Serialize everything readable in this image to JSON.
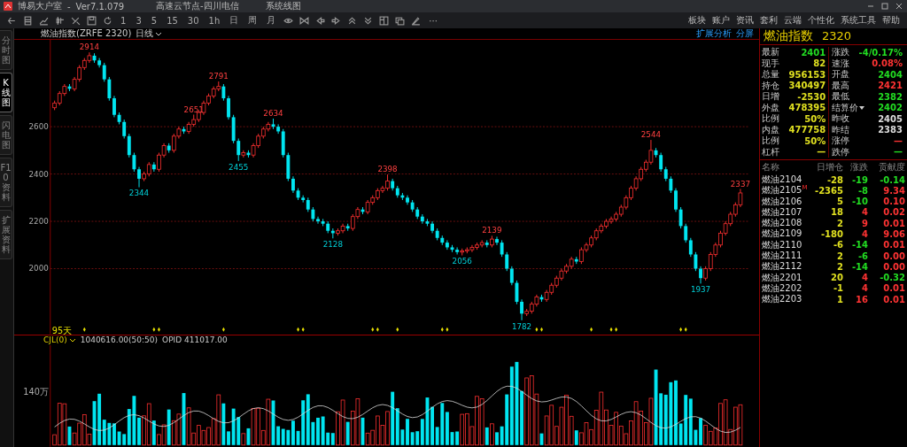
{
  "window": {
    "title": "博易大户室",
    "separator": "-",
    "version": "Ver7.1.079",
    "server": "高速云节点-四川电信",
    "view": "系统线图"
  },
  "menu": [
    "板块",
    "账户",
    "资讯",
    "套利",
    "云端",
    "个性化",
    "系统工具",
    "帮助"
  ],
  "toolbar": {
    "periods": [
      "1",
      "3",
      "5",
      "15",
      "30",
      "1h",
      "日",
      "周",
      "月"
    ],
    "more": "···"
  },
  "side_tabs": [
    {
      "label": "分时图",
      "selected": false
    },
    {
      "label": "K线图",
      "selected": true
    },
    {
      "label": "闪电图",
      "selected": false
    },
    {
      "label": "F10资料",
      "selected": false
    },
    {
      "label": "扩展资料",
      "selected": false
    }
  ],
  "chart_header": {
    "symbol": "燃油指数(ZRFE 2320)",
    "period": "日线",
    "analysis": "扩展分析",
    "split": "分屏"
  },
  "chart_data": {
    "type": "candlestick",
    "grid": true,
    "ylim": [
      1723,
      2967
    ],
    "yticks": [
      2000,
      2200,
      2400,
      2600
    ],
    "ohlc": [
      [
        2680,
        2710,
        2670,
        2700
      ],
      [
        2700,
        2750,
        2690,
        2740
      ],
      [
        2740,
        2780,
        2730,
        2770
      ],
      [
        2770,
        2780,
        2750,
        2760
      ],
      [
        2760,
        2810,
        2750,
        2800
      ],
      [
        2800,
        2860,
        2790,
        2850
      ],
      [
        2850,
        2890,
        2840,
        2880
      ],
      [
        2880,
        2914,
        2870,
        2900
      ],
      [
        2900,
        2910,
        2870,
        2880
      ],
      [
        2880,
        2890,
        2850,
        2860
      ],
      [
        2860,
        2870,
        2790,
        2800
      ],
      [
        2800,
        2810,
        2710,
        2720
      ],
      [
        2720,
        2730,
        2640,
        2650
      ],
      [
        2650,
        2660,
        2610,
        2620
      ],
      [
        2620,
        2630,
        2550,
        2560
      ],
      [
        2560,
        2570,
        2470,
        2480
      ],
      [
        2480,
        2490,
        2410,
        2420
      ],
      [
        2420,
        2430,
        2344,
        2380
      ],
      [
        2380,
        2410,
        2370,
        2400
      ],
      [
        2400,
        2450,
        2390,
        2440
      ],
      [
        2440,
        2450,
        2410,
        2420
      ],
      [
        2420,
        2490,
        2410,
        2480
      ],
      [
        2480,
        2530,
        2470,
        2520
      ],
      [
        2520,
        2530,
        2490,
        2500
      ],
      [
        2500,
        2570,
        2490,
        2560
      ],
      [
        2560,
        2600,
        2550,
        2590
      ],
      [
        2590,
        2600,
        2570,
        2580
      ],
      [
        2580,
        2620,
        2570,
        2610
      ],
      [
        2610,
        2651,
        2600,
        2630
      ],
      [
        2630,
        2670,
        2620,
        2660
      ],
      [
        2660,
        2710,
        2650,
        2700
      ],
      [
        2700,
        2740,
        2690,
        2730
      ],
      [
        2730,
        2770,
        2720,
        2760
      ],
      [
        2760,
        2791,
        2750,
        2770
      ],
      [
        2770,
        2780,
        2710,
        2720
      ],
      [
        2720,
        2730,
        2630,
        2640
      ],
      [
        2640,
        2650,
        2530,
        2540
      ],
      [
        2540,
        2550,
        2455,
        2480
      ],
      [
        2480,
        2500,
        2470,
        2490
      ],
      [
        2490,
        2500,
        2470,
        2480
      ],
      [
        2480,
        2530,
        2470,
        2520
      ],
      [
        2520,
        2570,
        2510,
        2560
      ],
      [
        2560,
        2600,
        2550,
        2590
      ],
      [
        2590,
        2620,
        2580,
        2610
      ],
      [
        2610,
        2634,
        2590,
        2600
      ],
      [
        2600,
        2610,
        2570,
        2580
      ],
      [
        2580,
        2590,
        2470,
        2480
      ],
      [
        2480,
        2490,
        2370,
        2380
      ],
      [
        2380,
        2390,
        2320,
        2330
      ],
      [
        2330,
        2340,
        2290,
        2300
      ],
      [
        2300,
        2310,
        2280,
        2290
      ],
      [
        2290,
        2300,
        2240,
        2250
      ],
      [
        2250,
        2260,
        2200,
        2210
      ],
      [
        2210,
        2220,
        2190,
        2200
      ],
      [
        2200,
        2210,
        2180,
        2190
      ],
      [
        2190,
        2200,
        2150,
        2160
      ],
      [
        2160,
        2170,
        2128,
        2150
      ],
      [
        2150,
        2170,
        2140,
        2160
      ],
      [
        2160,
        2190,
        2150,
        2180
      ],
      [
        2180,
        2190,
        2160,
        2170
      ],
      [
        2170,
        2230,
        2160,
        2220
      ],
      [
        2220,
        2260,
        2210,
        2250
      ],
      [
        2250,
        2260,
        2230,
        2240
      ],
      [
        2240,
        2290,
        2230,
        2280
      ],
      [
        2280,
        2310,
        2270,
        2300
      ],
      [
        2300,
        2340,
        2290,
        2330
      ],
      [
        2330,
        2350,
        2320,
        2340
      ],
      [
        2340,
        2398,
        2330,
        2370
      ],
      [
        2370,
        2380,
        2330,
        2340
      ],
      [
        2340,
        2350,
        2300,
        2310
      ],
      [
        2310,
        2320,
        2290,
        2300
      ],
      [
        2300,
        2310,
        2270,
        2280
      ],
      [
        2280,
        2290,
        2240,
        2250
      ],
      [
        2250,
        2260,
        2210,
        2220
      ],
      [
        2220,
        2230,
        2190,
        2200
      ],
      [
        2200,
        2210,
        2180,
        2190
      ],
      [
        2190,
        2200,
        2150,
        2160
      ],
      [
        2160,
        2170,
        2120,
        2130
      ],
      [
        2130,
        2140,
        2100,
        2110
      ],
      [
        2110,
        2120,
        2080,
        2090
      ],
      [
        2090,
        2100,
        2070,
        2080
      ],
      [
        2080,
        2090,
        2060,
        2070
      ],
      [
        2070,
        2085,
        2056,
        2075
      ],
      [
        2075,
        2090,
        2065,
        2080
      ],
      [
        2080,
        2100,
        2070,
        2090
      ],
      [
        2090,
        2110,
        2080,
        2100
      ],
      [
        2100,
        2120,
        2090,
        2110
      ],
      [
        2110,
        2120,
        2090,
        2100
      ],
      [
        2100,
        2139,
        2090,
        2125
      ],
      [
        2125,
        2135,
        2100,
        2110
      ],
      [
        2110,
        2120,
        2050,
        2060
      ],
      [
        2060,
        2070,
        1990,
        2000
      ],
      [
        2000,
        2010,
        1930,
        1940
      ],
      [
        1940,
        1950,
        1850,
        1860
      ],
      [
        1860,
        1870,
        1782,
        1810
      ],
      [
        1810,
        1830,
        1800,
        1820
      ],
      [
        1820,
        1860,
        1810,
        1850
      ],
      [
        1850,
        1890,
        1840,
        1880
      ],
      [
        1880,
        1890,
        1860,
        1870
      ],
      [
        1870,
        1910,
        1860,
        1900
      ],
      [
        1900,
        1940,
        1890,
        1930
      ],
      [
        1930,
        1970,
        1920,
        1960
      ],
      [
        1960,
        2000,
        1950,
        1990
      ],
      [
        1990,
        2020,
        1980,
        2010
      ],
      [
        2010,
        2050,
        2000,
        2040
      ],
      [
        2040,
        2050,
        2020,
        2030
      ],
      [
        2030,
        2090,
        2020,
        2080
      ],
      [
        2080,
        2110,
        2070,
        2100
      ],
      [
        2100,
        2140,
        2090,
        2130
      ],
      [
        2130,
        2170,
        2120,
        2160
      ],
      [
        2160,
        2190,
        2150,
        2180
      ],
      [
        2180,
        2210,
        2170,
        2200
      ],
      [
        2200,
        2220,
        2190,
        2210
      ],
      [
        2210,
        2240,
        2200,
        2230
      ],
      [
        2230,
        2270,
        2220,
        2260
      ],
      [
        2260,
        2310,
        2250,
        2300
      ],
      [
        2300,
        2350,
        2290,
        2340
      ],
      [
        2340,
        2390,
        2330,
        2380
      ],
      [
        2380,
        2430,
        2370,
        2420
      ],
      [
        2420,
        2460,
        2410,
        2450
      ],
      [
        2450,
        2544,
        2440,
        2500
      ],
      [
        2500,
        2510,
        2470,
        2480
      ],
      [
        2480,
        2490,
        2410,
        2420
      ],
      [
        2420,
        2430,
        2370,
        2380
      ],
      [
        2380,
        2390,
        2320,
        2330
      ],
      [
        2330,
        2340,
        2240,
        2250
      ],
      [
        2250,
        2260,
        2170,
        2180
      ],
      [
        2180,
        2190,
        2110,
        2120
      ],
      [
        2120,
        2130,
        2050,
        2060
      ],
      [
        2060,
        2070,
        1990,
        2000
      ],
      [
        2000,
        2010,
        1937,
        1960
      ],
      [
        1960,
        2010,
        1950,
        2000
      ],
      [
        2000,
        2070,
        1990,
        2060
      ],
      [
        2060,
        2110,
        2050,
        2100
      ],
      [
        2100,
        2160,
        2090,
        2150
      ],
      [
        2150,
        2200,
        2140,
        2190
      ],
      [
        2190,
        2240,
        2180,
        2230
      ],
      [
        2230,
        2280,
        2220,
        2270
      ],
      [
        2270,
        2337,
        2260,
        2320
      ]
    ],
    "annotations": [
      {
        "y": 2914,
        "text": "2914"
      },
      {
        "y": 2344,
        "text": "2344"
      },
      {
        "y": 2651,
        "text": "2651"
      },
      {
        "y": 2791,
        "text": "2791"
      },
      {
        "y": 2455,
        "text": "2455"
      },
      {
        "y": 2634,
        "text": "2634"
      },
      {
        "y": 2128,
        "text": "2128"
      },
      {
        "y": 2398,
        "text": "2398"
      },
      {
        "y": 2056,
        "text": "2056"
      },
      {
        "y": 2139,
        "text": "2139"
      },
      {
        "y": 1782,
        "text": "1782"
      },
      {
        "y": 2544,
        "text": "2544"
      },
      {
        "y": 1937,
        "text": "1937"
      },
      {
        "y": 2337,
        "text": "2337"
      }
    ]
  },
  "signal_row": {
    "label": "95天"
  },
  "volume": {
    "indicator": "CJL(0)",
    "value": "1040616.00(50:50)",
    "opid": "OPID 411017.00",
    "axis_label": "140万"
  },
  "quote": {
    "name": "燃油指数",
    "price": "2320"
  },
  "stats": [
    {
      "left": {
        "label": "最新",
        "value": "2401",
        "color": "#22dd22"
      },
      "right": {
        "label": "涨跌",
        "value": "-4/0.17%",
        "color": "#22dd22"
      }
    },
    {
      "left": {
        "label": "现手",
        "value": "82",
        "color": "#e0e020"
      },
      "right": {
        "label": "速涨",
        "value": "0.08%",
        "color": "#ff3333"
      }
    },
    {
      "left": {
        "label": "总量",
        "value": "956153",
        "color": "#e0e020"
      },
      "right": {
        "label": "开盘",
        "value": "2404",
        "color": "#22dd22"
      }
    },
    {
      "left": {
        "label": "持仓",
        "value": "340497",
        "color": "#e0e020"
      },
      "right": {
        "label": "最高",
        "value": "2421",
        "color": "#ff3333"
      }
    },
    {
      "left": {
        "label": "日增",
        "value": "-2530",
        "color": "#e0e020"
      },
      "right": {
        "label": "最低",
        "value": "2382",
        "color": "#22dd22"
      }
    },
    {
      "left": {
        "label": "外盘",
        "value": "478395",
        "color": "#e0e020"
      },
      "right": {
        "label": "结算价",
        "value": "2402",
        "color": "#22dd22",
        "dropdown": true
      }
    },
    {
      "left": {
        "label": "比例",
        "value": "50%",
        "color": "#e0e020"
      },
      "right": {
        "label": "昨收",
        "value": "2405",
        "color": "#dddddd"
      }
    },
    {
      "left": {
        "label": "内盘",
        "value": "477758",
        "color": "#e0e020"
      },
      "right": {
        "label": "昨结",
        "value": "2383",
        "color": "#dddddd"
      }
    },
    {
      "left": {
        "label": "比例",
        "value": "50%",
        "color": "#e0e020"
      },
      "right": {
        "label": "涨停",
        "value": "—",
        "color": "#ff3333"
      }
    },
    {
      "left": {
        "label": "杠杆",
        "value": "—",
        "color": "#e0e020"
      },
      "right": {
        "label": "跌停",
        "value": "—",
        "color": "#22dd22"
      }
    }
  ],
  "contracts": {
    "columns": [
      "名称",
      "日增仓",
      "涨跌",
      "贡献度"
    ],
    "rows": [
      {
        "name": "燃油2104",
        "oi": "-28",
        "change": {
          "text": "-19",
          "color": "#22dd22"
        },
        "contrib": {
          "text": "-0.14",
          "color": "#22dd22"
        }
      },
      {
        "name": "燃油2105",
        "badge": "M",
        "oi": "-2365",
        "change": {
          "text": "-8",
          "color": "#22dd22"
        },
        "contrib": {
          "text": "9.34",
          "color": "#ff3333"
        }
      },
      {
        "name": "燃油2106",
        "oi": "5",
        "change": {
          "text": "-10",
          "color": "#22dd22"
        },
        "contrib": {
          "text": "0.10",
          "color": "#ff3333"
        }
      },
      {
        "name": "燃油2107",
        "oi": "18",
        "change": {
          "text": "4",
          "color": "#ff3333"
        },
        "contrib": {
          "text": "0.02",
          "color": "#ff3333"
        }
      },
      {
        "name": "燃油2108",
        "oi": "2",
        "change": {
          "text": "9",
          "color": "#ff3333"
        },
        "contrib": {
          "text": "0.01",
          "color": "#ff3333"
        }
      },
      {
        "name": "燃油2109",
        "oi": "-180",
        "change": {
          "text": "4",
          "color": "#ff3333"
        },
        "contrib": {
          "text": "9.06",
          "color": "#ff3333"
        }
      },
      {
        "name": "燃油2110",
        "oi": "-6",
        "change": {
          "text": "-14",
          "color": "#22dd22"
        },
        "contrib": {
          "text": "0.01",
          "color": "#ff3333"
        }
      },
      {
        "name": "燃油2111",
        "oi": "2",
        "change": {
          "text": "-6",
          "color": "#22dd22"
        },
        "contrib": {
          "text": "0.00",
          "color": "#ff3333"
        }
      },
      {
        "name": "燃油2112",
        "oi": "2",
        "change": {
          "text": "-14",
          "color": "#22dd22"
        },
        "contrib": {
          "text": "0.00",
          "color": "#ff3333"
        }
      },
      {
        "name": "燃油2201",
        "oi": "20",
        "change": {
          "text": "4",
          "color": "#ff3333"
        },
        "contrib": {
          "text": "-0.32",
          "color": "#22dd22"
        }
      },
      {
        "name": "燃油2202",
        "oi": "-1",
        "change": {
          "text": "4",
          "color": "#ff3333"
        },
        "contrib": {
          "text": "0.01",
          "color": "#ff3333"
        }
      },
      {
        "name": "燃油2203",
        "oi": "1",
        "change": {
          "text": "16",
          "color": "#ff3333"
        },
        "contrib": {
          "text": "0.01",
          "color": "#ff3333"
        }
      }
    ]
  }
}
